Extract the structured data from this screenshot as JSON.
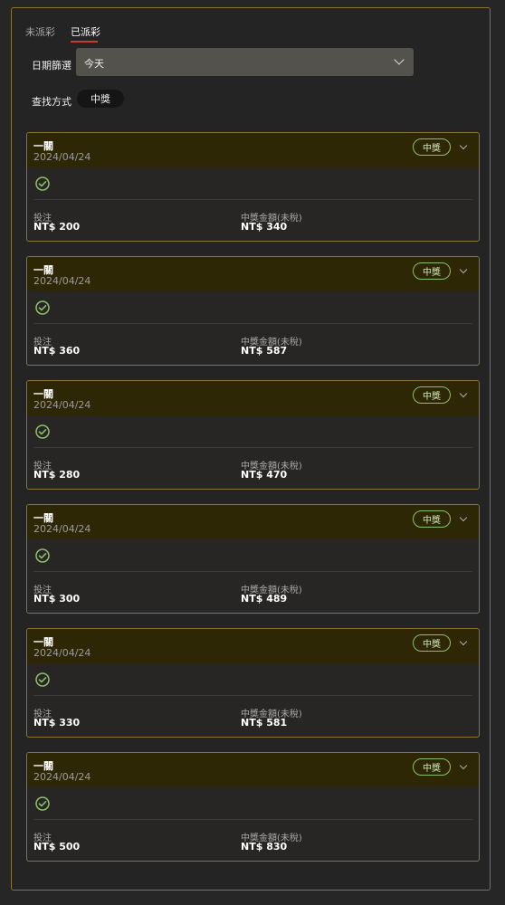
{
  "tabs": [
    {
      "label": "未派彩",
      "active": false
    },
    {
      "label": "已派彩",
      "active": true
    }
  ],
  "filter": {
    "label": "日期篩選",
    "selected": "今天"
  },
  "search_mode": {
    "label": "查找方式",
    "value": "中獎"
  },
  "bet_label": "投注",
  "prize_label": "中獎金額(未稅)",
  "badge_label": "中獎",
  "cards": [
    {
      "title": "一關",
      "date": "2024/04/24",
      "bet": "NT$ 200",
      "prize": "NT$ 340"
    },
    {
      "title": "一關",
      "date": "2024/04/24",
      "bet": "NT$ 360",
      "prize": "NT$ 587"
    },
    {
      "title": "一關",
      "date": "2024/04/24",
      "bet": "NT$ 280",
      "prize": "NT$ 470"
    },
    {
      "title": "一關",
      "date": "2024/04/24",
      "bet": "NT$ 300",
      "prize": "NT$ 489"
    },
    {
      "title": "一關",
      "date": "2024/04/24",
      "bet": "NT$ 330",
      "prize": "NT$ 581"
    },
    {
      "title": "一關",
      "date": "2024/04/24",
      "bet": "NT$ 500",
      "prize": "NT$ 830"
    }
  ],
  "colors": {
    "accent_border": "#8a7431",
    "tab_underline": "#c83a33",
    "win_green": "#8fbf6a"
  }
}
